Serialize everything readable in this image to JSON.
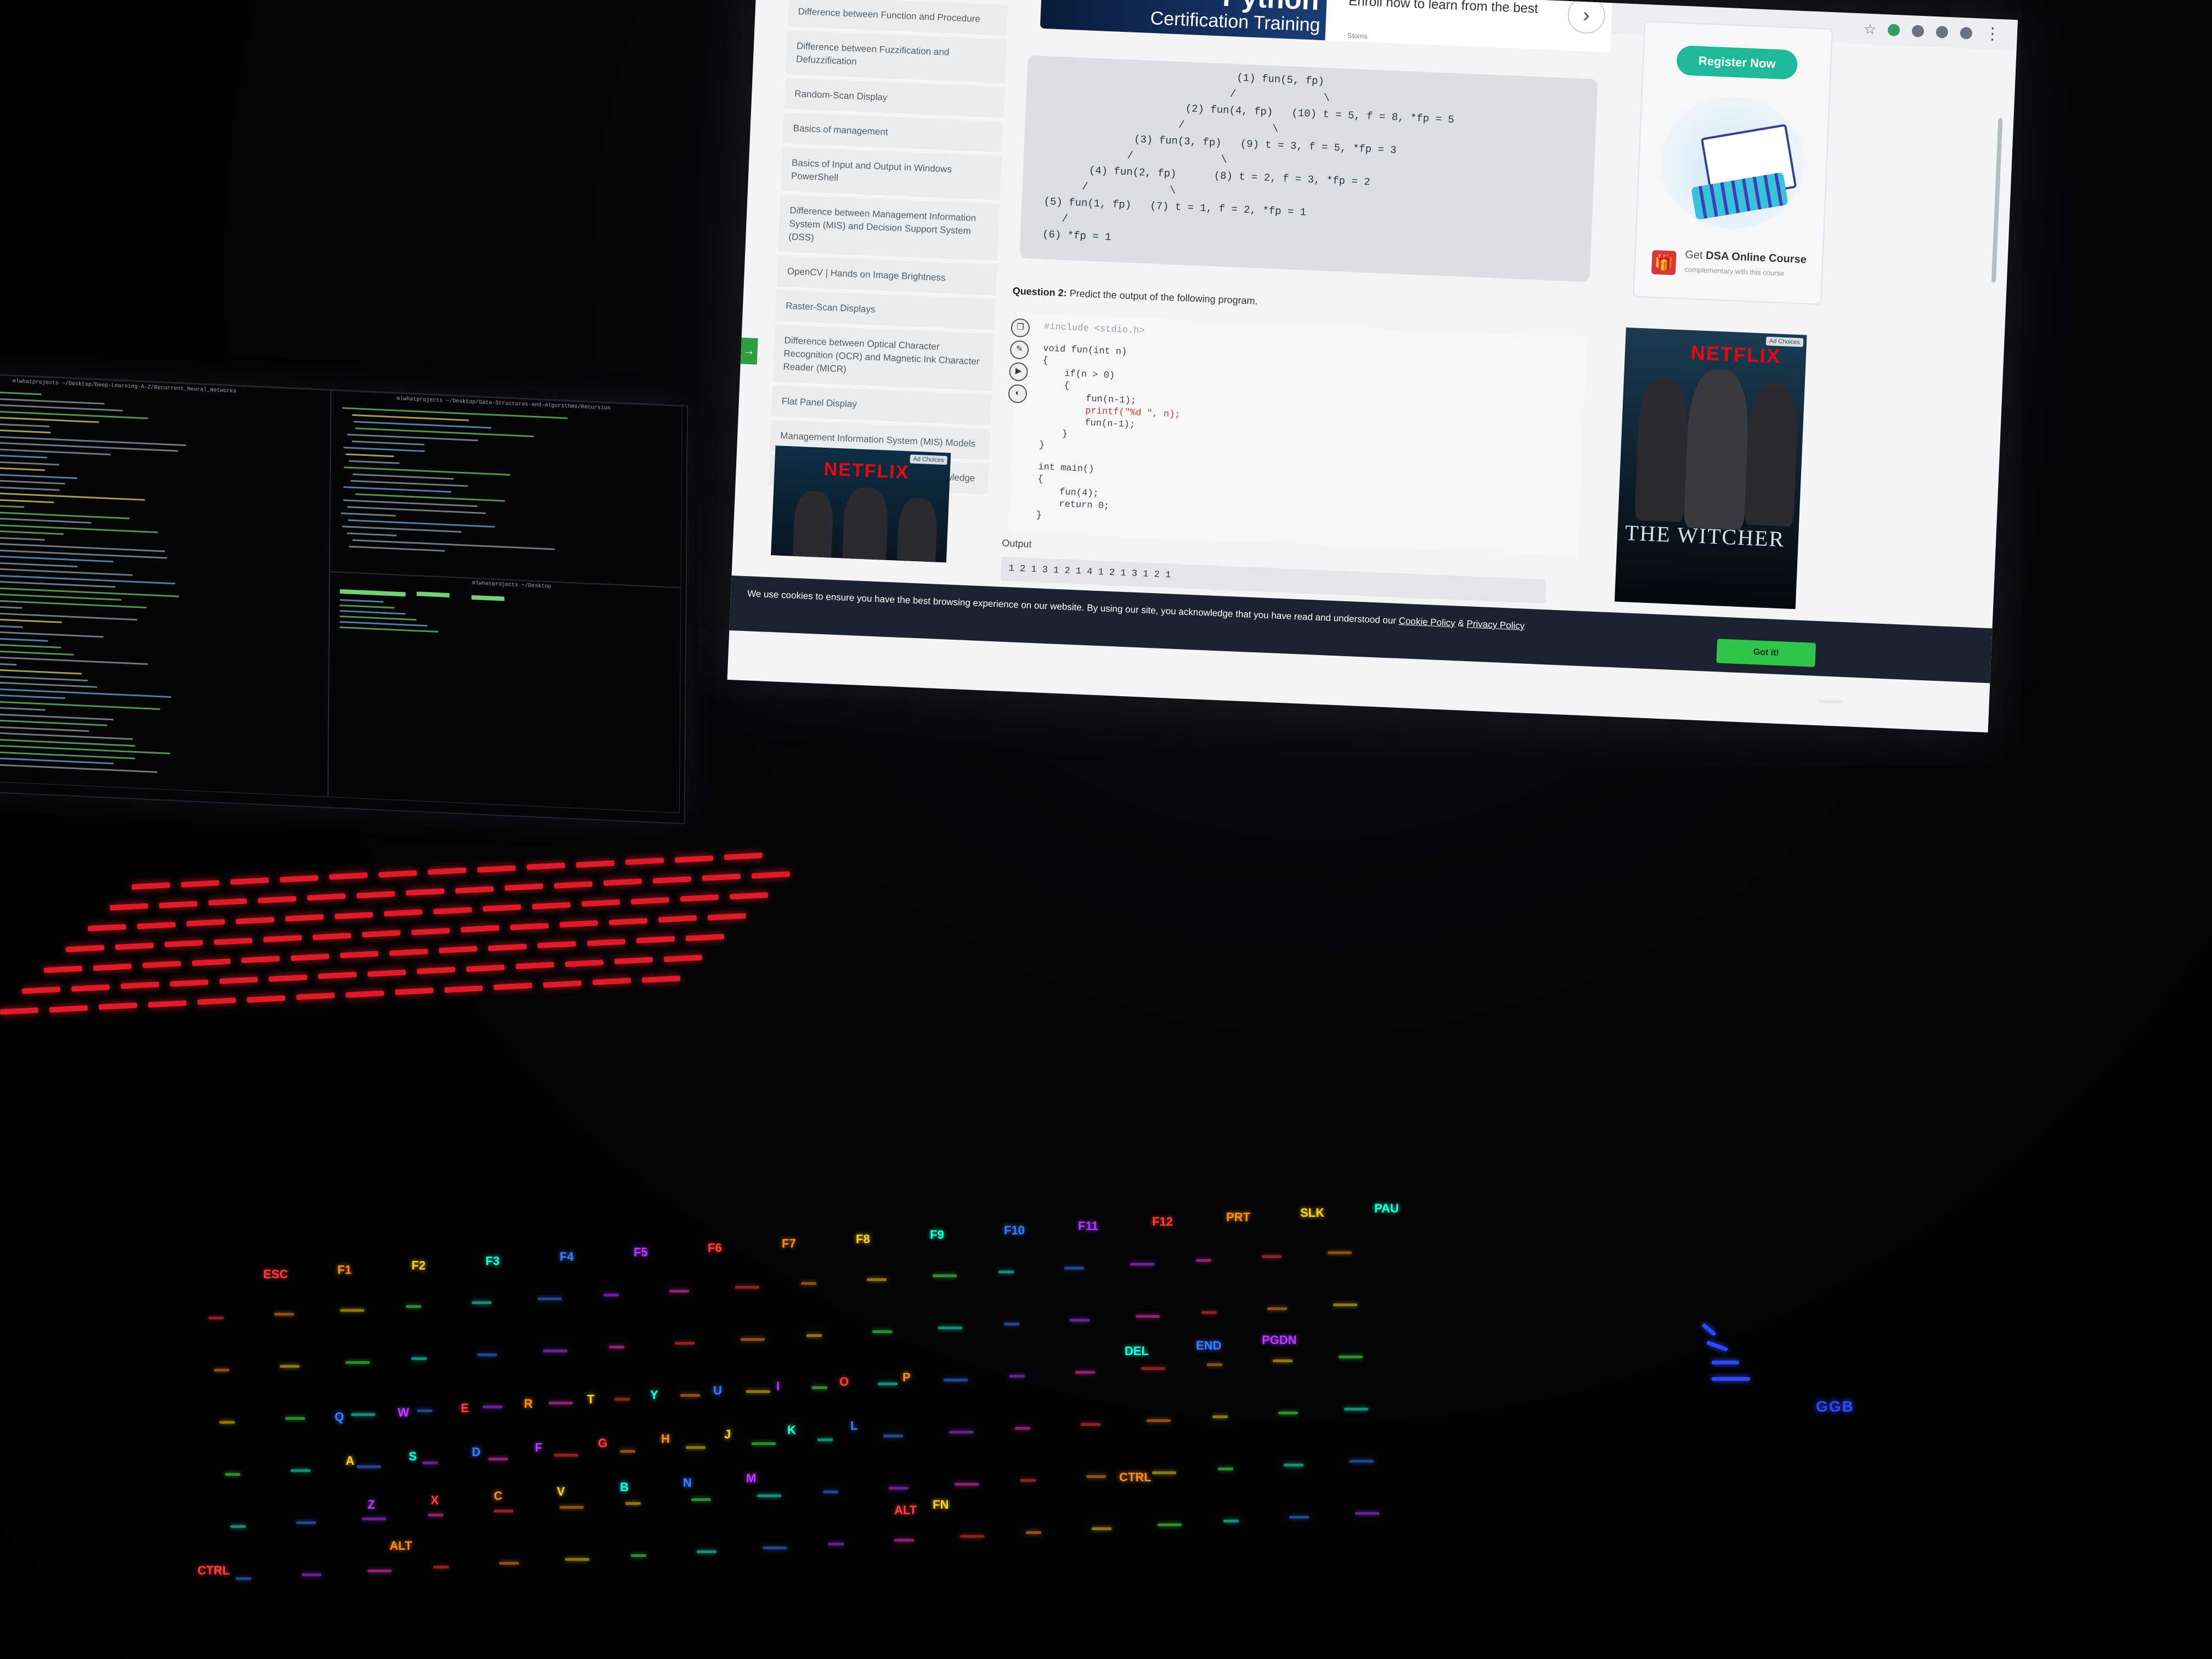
{
  "browser": {
    "sidebar_items": [
      "Difference between Function and Procedure",
      "Difference between Fuzzification and Defuzzification",
      "Random-Scan Display",
      "Basics of management",
      "Basics of Input and Output in Windows PowerShell",
      "Difference between Management Information System (MIS) and Decision Support System (DSS)",
      "OpenCV | Hands on Image Brightness",
      "Raster-Scan Displays",
      "Difference between Optical Character Recognition (OCR) and Magnetic Ink Character Reader (MICR)",
      "Flat Panel Display",
      "Management Information System (MIS) Models",
      "Difference between Information and Knowledge"
    ],
    "banner": {
      "title": "Python",
      "subtitle": "Certification Training",
      "enroll_text": "Enroll now to learn from the best",
      "small": "Stoms"
    },
    "tree_lines": [
      "                              (1) fun(5, fp)",
      "                             /              \\",
      "                      (2) fun(4, fp)   (10) t = 5, f = 8, *fp = 5",
      "                     /              \\",
      "              (3) fun(3, fp)   (9) t = 3, f = 5, *fp = 3",
      "             /              \\",
      "       (4) fun(2, fp)      (8) t = 2, f = 3, *fp = 2",
      "      /             \\",
      "(5) fun(1, fp)   (7) t = 1, f = 2, *fp = 1",
      "   /",
      "(6) *fp = 1"
    ],
    "question_label": "Question 2:",
    "question_text": "Predict the output of the following program.",
    "code_lines": [
      "#include <stdio.h>",
      "void fun(int n)",
      "{",
      "    if(n > 0)",
      "    {",
      "        fun(n-1);",
      "        printf(\"%d \", n);",
      "        fun(n-1);",
      "    }",
      "}",
      "int main()",
      "{",
      "    fun(4);",
      "    return 0;",
      "}"
    ],
    "output_label": "Output",
    "output_value": "1 2 1 3 1 2 1 4 1 2 1 3 1 2 1",
    "register_label": "Register Now",
    "dsa_prefix": "Get",
    "dsa_bold": "DSA Online Course",
    "dsa_sub": "complementary with this course",
    "netflix": "NETFLIX",
    "ad_badge": "Ad Choices",
    "witcher": "THE WITCHER",
    "cookie": {
      "text": "We use cookies to ensure you have the best browsing experience on our website. By using our site, you acknowledge that you have read and understood our",
      "cookie_policy": "Cookie Policy",
      "amp": "&",
      "privacy_policy": "Privacy Policy",
      "button": "Got it!"
    }
  },
  "terminal": {
    "title_left": "mlwhatprojects ~/Desktop/Deep-Learning-A-Z/Recurrent_Neural_Networks",
    "title_right": "mlwhatprojects ~/Desktop/Data-Structures-and-Algorithms/Recursion",
    "title_bottom": "mlwhatprojects ~/Desktop"
  },
  "keyboard": {
    "keys": [
      "ESC",
      "F1",
      "F2",
      "F3",
      "F4",
      "F5",
      "F6",
      "F7",
      "F8",
      "F9",
      "F10",
      "F11",
      "F12",
      "PRT",
      "SLK",
      "PAU",
      "Q",
      "W",
      "E",
      "R",
      "T",
      "Y",
      "U",
      "I",
      "O",
      "P",
      "A",
      "S",
      "D",
      "F",
      "G",
      "H",
      "J",
      "K",
      "L",
      "Z",
      "X",
      "C",
      "V",
      "B",
      "N",
      "M",
      "CTRL",
      "ALT",
      "FN",
      "DEL",
      "END",
      "PGDN",
      "ALT",
      "CTRL"
    ],
    "mouse_label": "GGB"
  },
  "colors": {
    "accent_green": "#2fc54a",
    "register_teal": "#1fb89a",
    "netflix_red": "#e50914",
    "laptop_kb_red": "#e11a2a",
    "mouse_blue": "#2d49ff"
  }
}
